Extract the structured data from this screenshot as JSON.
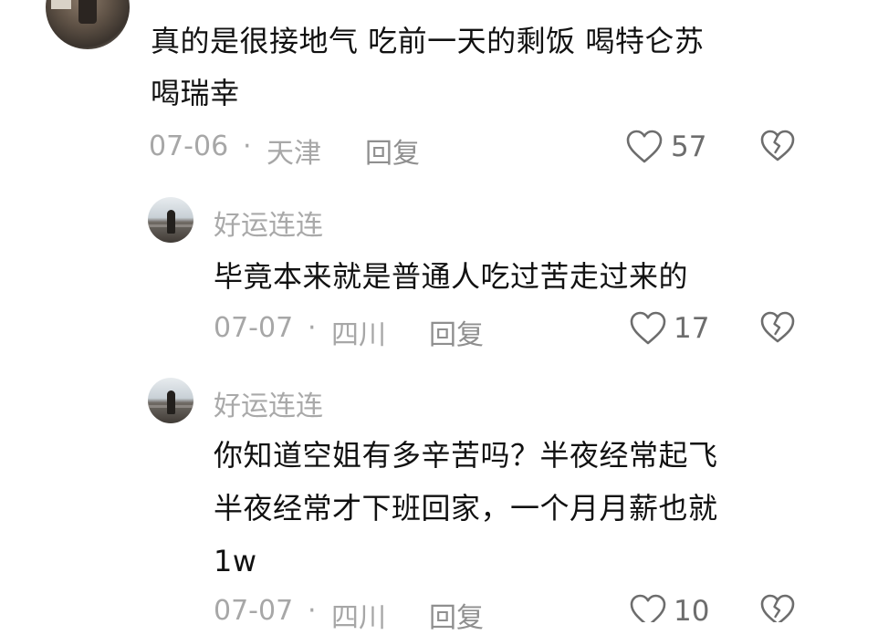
{
  "comments": [
    {
      "text_line1": "真的是很接地气 吃前一天的剩饭 喝特仑苏",
      "text_line2": "喝瑞幸",
      "date": "07-06",
      "location": "天津",
      "reply_label": "回复",
      "like_count": "57"
    },
    {
      "username": "好运连连",
      "text_line1": "毕竟本来就是普通人吃过苦走过来的",
      "date": "07-07",
      "location": "四川",
      "reply_label": "回复",
      "like_count": "17"
    },
    {
      "username": "好运连连",
      "text_line1": "你知道空姐有多辛苦吗？半夜经常起飞",
      "text_line2": "半夜经常才下班回家，一个月月薪也就",
      "text_line3": "1w",
      "date": "07-07",
      "location": "四川",
      "reply_label": "回复",
      "like_count": "10"
    }
  ],
  "separator": "·",
  "icons": {
    "like": "heart-outline-icon",
    "dislike": "broken-heart-icon"
  },
  "colors": {
    "icon": "#6d6d6d",
    "meta": "#a7a7a7"
  }
}
